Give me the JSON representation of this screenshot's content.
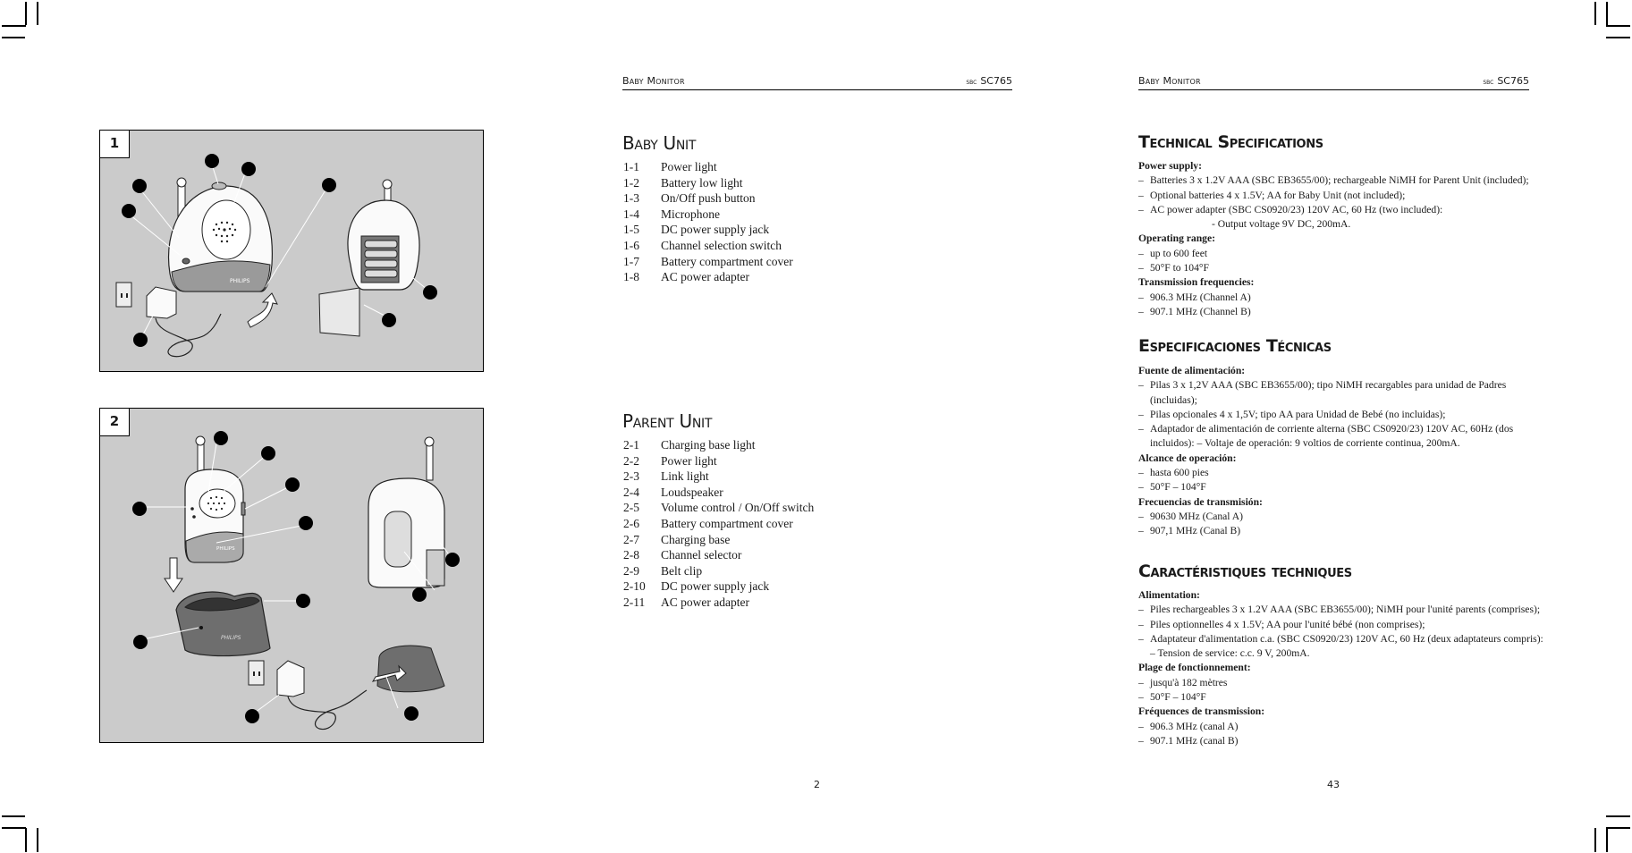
{
  "left_page": {
    "header": {
      "title": "Baby Monitor",
      "model_prefix": "sbc",
      "model": "SC765"
    },
    "figures": [
      {
        "label": "1",
        "callout_count": 8
      },
      {
        "label": "2",
        "callout_count": 11
      }
    ],
    "sections": [
      {
        "title": "Baby Unit",
        "items": [
          {
            "num": "1-1",
            "text": "Power light"
          },
          {
            "num": "1-2",
            "text": "Battery low light"
          },
          {
            "num": "1-3",
            "text": "On/Off push button"
          },
          {
            "num": "1-4",
            "text": "Microphone"
          },
          {
            "num": "1-5",
            "text": "DC power supply jack"
          },
          {
            "num": "1-6",
            "text": "Channel selection switch"
          },
          {
            "num": "1-7",
            "text": "Battery compartment cover"
          },
          {
            "num": "1-8",
            "text": "AC power adapter"
          }
        ]
      },
      {
        "title": "Parent Unit",
        "items": [
          {
            "num": "2-1",
            "text": "Charging base light"
          },
          {
            "num": "2-2",
            "text": "Power light"
          },
          {
            "num": "2-3",
            "text": "Link light"
          },
          {
            "num": "2-4",
            "text": "Loudspeaker"
          },
          {
            "num": "2-5",
            "text": "Volume control / On/Off switch"
          },
          {
            "num": "2-6",
            "text": "Battery compartment cover"
          },
          {
            "num": "2-7",
            "text": "Charging base"
          },
          {
            "num": "2-8",
            "text": "Channel selector"
          },
          {
            "num": "2-9",
            "text": "Belt clip"
          },
          {
            "num": "2-10",
            "text": "DC power supply jack"
          },
          {
            "num": "2-11",
            "text": "AC power adapter"
          }
        ]
      }
    ],
    "page_number": "2"
  },
  "right_page": {
    "header": {
      "title": "Baby Monitor",
      "model_prefix": "sbc",
      "model": "SC765"
    },
    "sections": [
      {
        "title": "Technical Specifications",
        "groups": [
          {
            "label": "Power supply:",
            "items": [
              "Batteries 3 x 1.2V AAA (SBC EB3655/00); rechargeable NiMH for Parent Unit (included);",
              "Optional batteries 4 x 1.5V; AA for Baby Unit (not included);",
              "AC power adapter (SBC CS0920/23) 120V AC, 60 Hz (two included):"
            ],
            "sub": "- Output voltage 9V DC, 200mA."
          },
          {
            "label": "Operating range:",
            "items": [
              "up to 600 feet",
              "50°F to 104°F"
            ]
          },
          {
            "label": "Transmission frequencies:",
            "items": [
              "906.3 MHz (Channel A)",
              "907.1 MHz (Channel B)"
            ]
          }
        ]
      },
      {
        "title": "Especificaciones Técnicas",
        "groups": [
          {
            "label": "Fuente de alimentación:",
            "items": [
              "Pilas 3 x 1,2V AAA (SBC EB3655/00); tipo NiMH recargables para unidad de Padres (incluidas);",
              "Pilas opcionales 4 x 1,5V; tipo AA para Unidad de Bebé (no incluidas);",
              "Adaptador de alimentación de corriente alterna (SBC CS0920/23) 120V AC, 60Hz (dos incluidos): – Voltaje de operación: 9 voltios de corriente continua, 200mA."
            ]
          },
          {
            "label": "Alcance de operación:",
            "items": [
              "hasta 600 pies",
              "50°F – 104°F"
            ]
          },
          {
            "label": "Frecuencias de transmisión:",
            "items": [
              "90630 MHz (Canal A)",
              "907,1 MHz (Canal B)"
            ]
          }
        ]
      },
      {
        "title": "Caractéristiques techniques",
        "groups": [
          {
            "label": "Alimentation:",
            "items": [
              "Piles rechargeables 3 x 1.2V AAA (SBC EB3655/00); NiMH pour l'unité parents (comprises);",
              "Piles optionnelles 4 x 1.5V; AA pour l'unité bébé (non comprises);",
              "Adaptateur d'alimentation c.a. (SBC CS0920/23) 120V AC, 60 Hz (deux adaptateurs compris):        – Tension de service: c.c. 9 V, 200mA."
            ]
          },
          {
            "label": "Plage de fonctionnement:",
            "items": [
              "jusqu'à 182 mètres",
              "50°F – 104°F"
            ]
          },
          {
            "label": "Fréquences de transmission:",
            "items": [
              "906.3 MHz (canal A)",
              "907.1 MHz (canal B)"
            ]
          }
        ]
      }
    ],
    "page_number": "43"
  }
}
